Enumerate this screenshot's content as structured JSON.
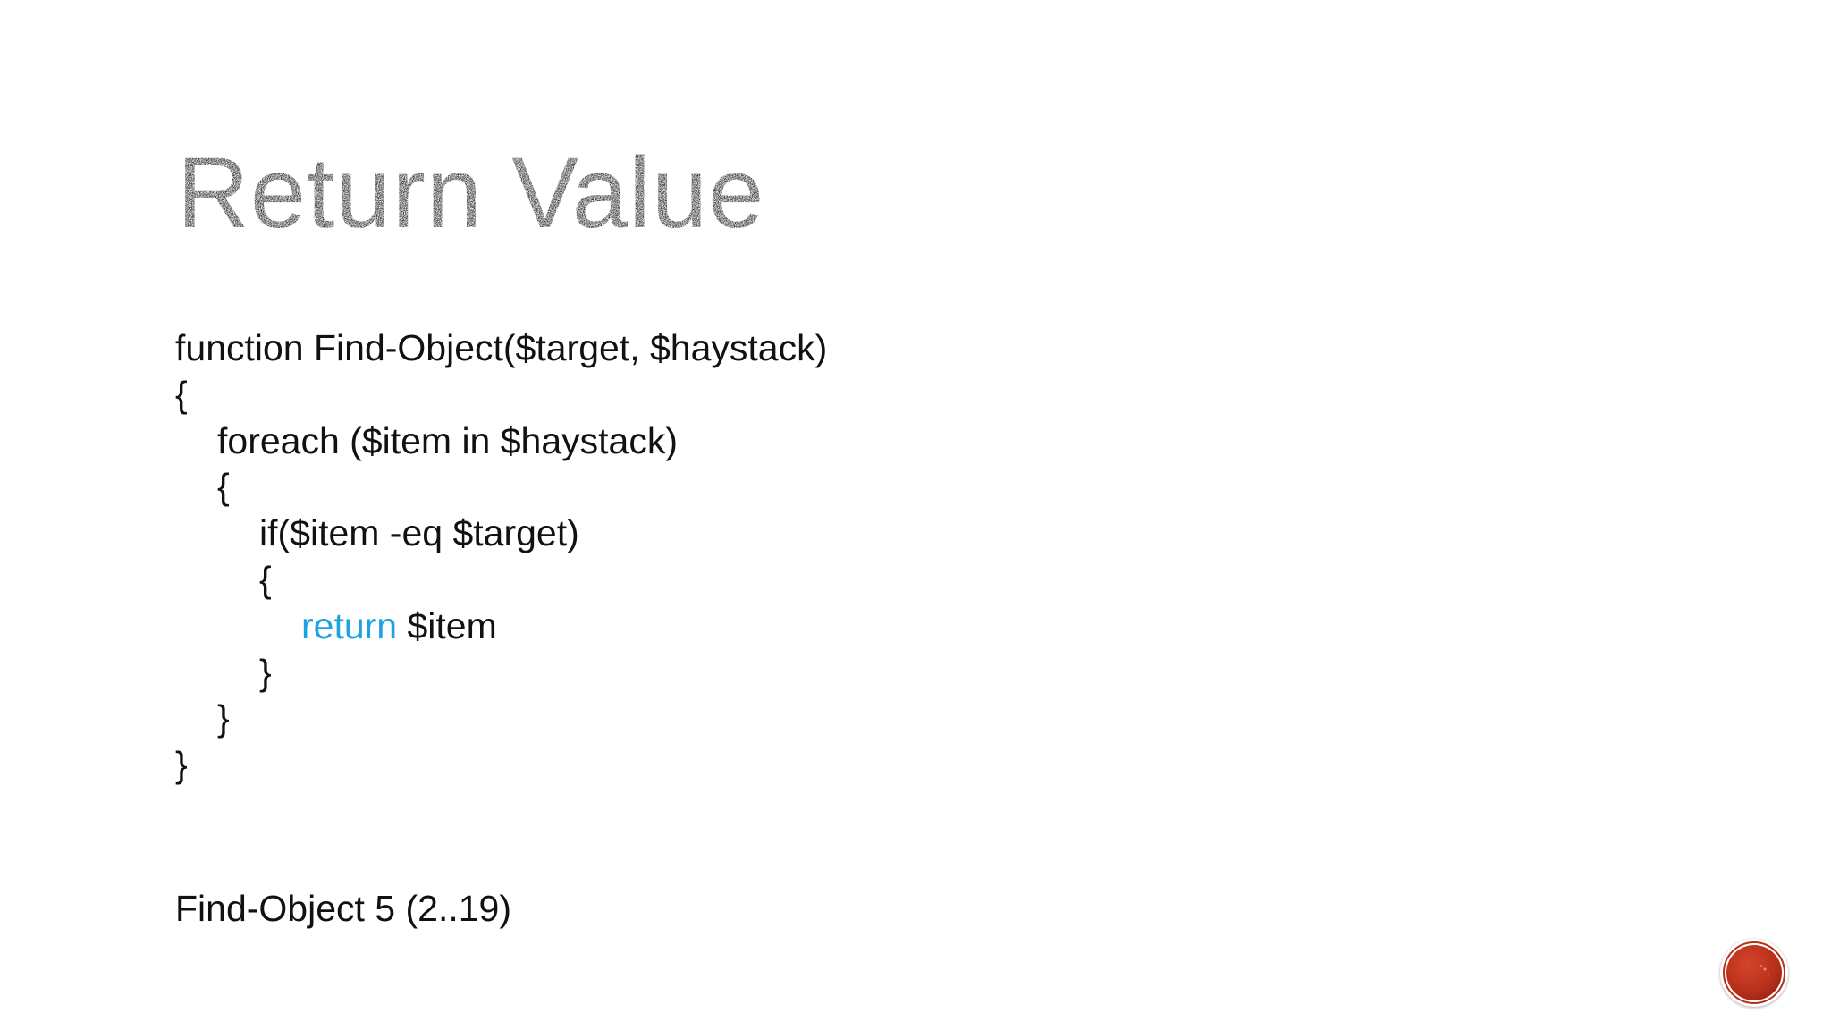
{
  "slide": {
    "title": "Return Value",
    "code": {
      "signature": "function Find-Object($target, $haystack)",
      "open_brace_outer": "{",
      "foreach": "foreach ($item in $haystack)",
      "open_brace_foreach": "{",
      "if": "if($item -eq $target)",
      "open_brace_if": "{",
      "return_keyword": "return",
      "return_value": " $item",
      "close_brace_if": "}",
      "close_brace_foreach": "}",
      "close_brace_outer": "}"
    },
    "usage": "Find-Object 5 (2..19)"
  },
  "colors": {
    "keyword": "#1ca3e0",
    "text": "#111111",
    "title": "#2b2b2b",
    "nav_button": "#c0341f"
  },
  "icons": {
    "nav": "red-circle-button-icon"
  }
}
